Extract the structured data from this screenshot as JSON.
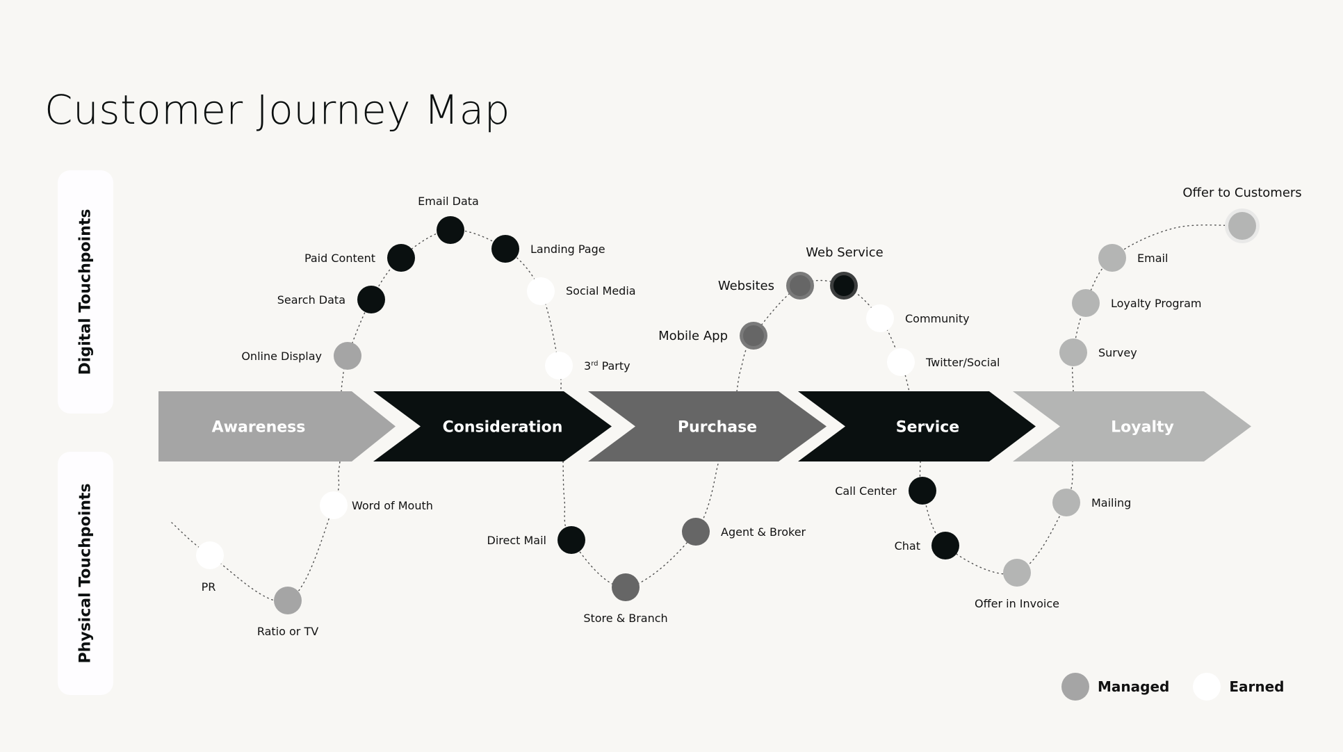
{
  "title": "Customer Journey Map",
  "side_labels": {
    "digital": "Digital Touchpoints",
    "physical": "Physical Touchpoints"
  },
  "colors": {
    "background": "#f8f7f4",
    "black": "#0a1010",
    "dark_gray": "#666666",
    "mid_gray": "#a5a5a5",
    "light_gray": "#b4b5b4",
    "white": "#ffffff",
    "ring_gray": "#7a7a7a",
    "ring_dark": "#3d3f3f",
    "halo": "#e9e9e8"
  },
  "stages": [
    {
      "label": "Awareness",
      "color": "#a5a5a5"
    },
    {
      "label": "Consideration",
      "color": "#0a1010"
    },
    {
      "label": "Purchase",
      "color": "#666666"
    },
    {
      "label": "Service",
      "color": "#0a1010"
    },
    {
      "label": "Loyalty",
      "color": "#b4b5b4"
    }
  ],
  "touchpoints": {
    "digital": [
      {
        "label": "Online Display",
        "stage": "Awareness",
        "fill": "#a5a5a5"
      },
      {
        "label": "Search Data",
        "stage": "Consideration",
        "fill": "#0a1010"
      },
      {
        "label": "Paid Content",
        "stage": "Consideration",
        "fill": "#0a1010"
      },
      {
        "label": "Email Data",
        "stage": "Consideration",
        "fill": "#0a1010"
      },
      {
        "label": "Landing Page",
        "stage": "Consideration",
        "fill": "#0a1010"
      },
      {
        "label": "Social Media",
        "stage": "Consideration",
        "fill": "#ffffff"
      },
      {
        "label": "3rd Party",
        "label_base": "3",
        "label_sup": "rd",
        "label_rest": " Party",
        "stage": "Consideration",
        "fill": "#ffffff"
      },
      {
        "label": "Mobile App",
        "stage": "Purchase",
        "fill": "#666666",
        "ring": "#7a7a7a"
      },
      {
        "label": "Websites",
        "stage": "Purchase",
        "fill": "#666666",
        "ring": "#7a7a7a"
      },
      {
        "label": "Web Service",
        "stage": "Service",
        "fill": "#0a1010",
        "ring": "#3d3f3f"
      },
      {
        "label": "Community",
        "stage": "Service",
        "fill": "#ffffff"
      },
      {
        "label": "Twitter/Social",
        "stage": "Service",
        "fill": "#ffffff"
      },
      {
        "label": "Survey",
        "stage": "Loyalty",
        "fill": "#b4b5b4"
      },
      {
        "label": "Loyalty Program",
        "stage": "Loyalty",
        "fill": "#b4b5b4"
      },
      {
        "label": "Email",
        "stage": "Loyalty",
        "fill": "#b4b5b4"
      },
      {
        "label": "Offer to Customers",
        "stage": "Loyalty",
        "fill": "#b4b5b4",
        "halo": "#e9e9e8"
      }
    ],
    "physical": [
      {
        "label": "PR",
        "stage": "Awareness",
        "fill": "#ffffff"
      },
      {
        "label": "Ratio or TV",
        "stage": "Awareness",
        "fill": "#a5a5a5"
      },
      {
        "label": "Word of Mouth",
        "stage": "Awareness",
        "fill": "#ffffff"
      },
      {
        "label": "Direct Mail",
        "stage": "Consideration",
        "fill": "#0a1010"
      },
      {
        "label": "Store & Branch",
        "stage": "Purchase",
        "fill": "#666666"
      },
      {
        "label": "Agent & Broker",
        "stage": "Purchase",
        "fill": "#666666"
      },
      {
        "label": "Call Center",
        "stage": "Service",
        "fill": "#0a1010"
      },
      {
        "label": "Chat",
        "stage": "Service",
        "fill": "#0a1010"
      },
      {
        "label": "Offer in Invoice",
        "stage": "Loyalty",
        "fill": "#b4b5b4"
      },
      {
        "label": "Mailing",
        "stage": "Loyalty",
        "fill": "#b4b5b4"
      }
    ]
  },
  "legend": [
    {
      "label": "Managed",
      "color": "#a5a5a5"
    },
    {
      "label": "Earned",
      "color": "#ffffff"
    }
  ]
}
